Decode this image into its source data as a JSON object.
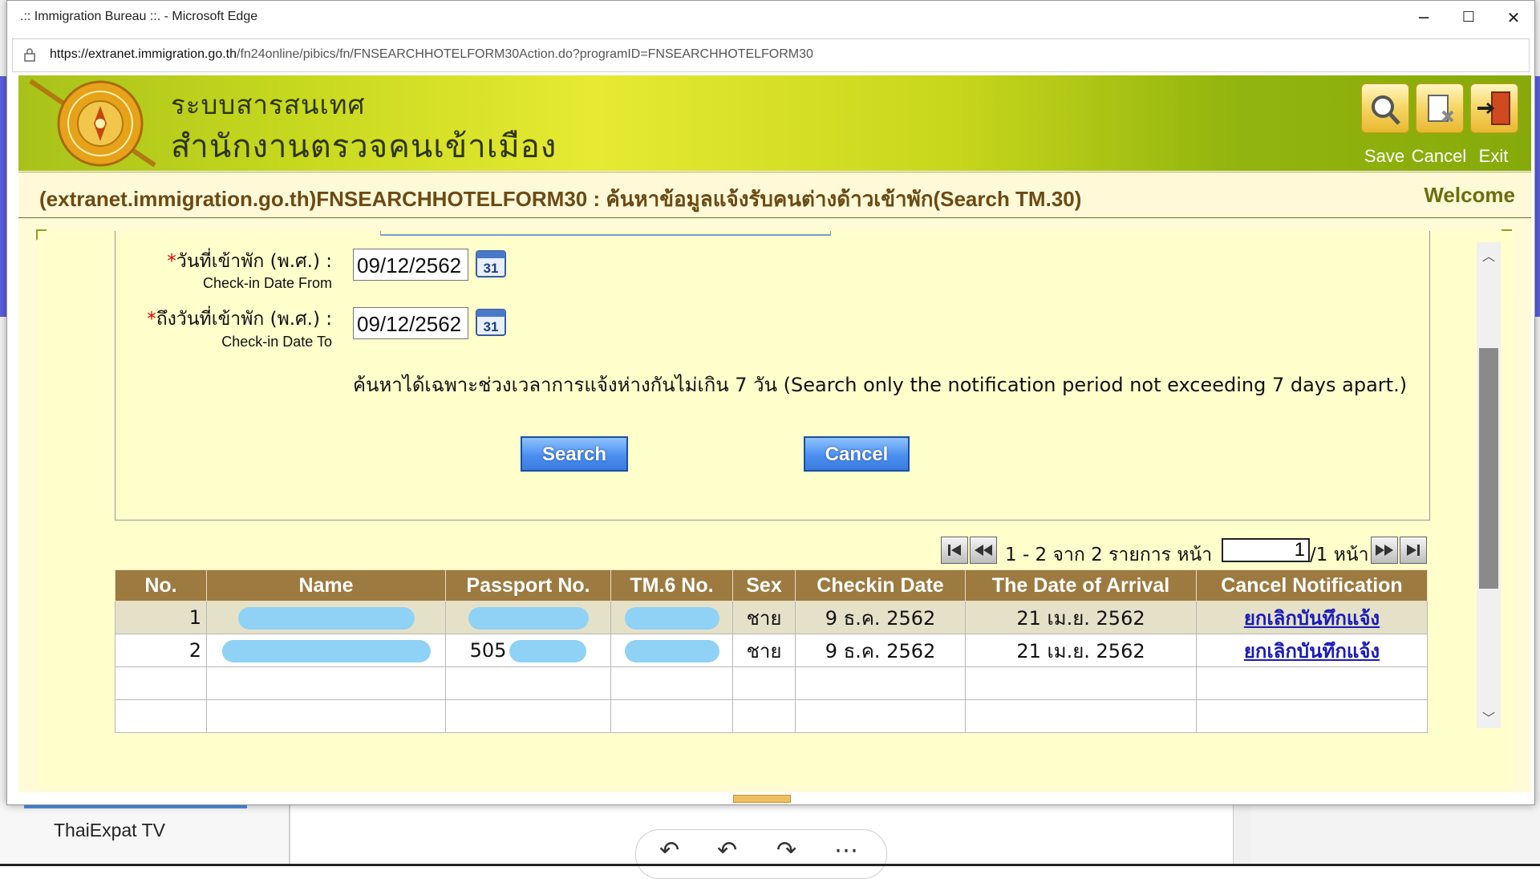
{
  "window": {
    "title": ".:: Immigration Bureau ::. - Microsoft Edge",
    "url_host": "https://extranet.immigration.go.th",
    "url_path": "/fn24online/pibics/fn/FNSEARCHHOTELFORM30Action.do?programID=FNSEARCHHOTELFORM30",
    "minimize": "─",
    "maximize": "☐",
    "close": "✕"
  },
  "header": {
    "title_th_line1": "ระบบสารสนเทศ",
    "title_th_line2": "สำนักงานตรวจคนเข้าเมือง",
    "buttons": {
      "save": "Save",
      "cancel": "Cancel",
      "exit": "Exit"
    }
  },
  "page": {
    "title": "(extranet.immigration.go.th)FNSEARCHHOTELFORM30 : ค้นหาข้อมูลแจ้งรับคนต่างด้าวเข้าพัก(Search TM.30)",
    "welcome": "Welcome"
  },
  "form": {
    "checkin_from": {
      "required_mark": "*",
      "label_th": "วันที่เข้าพัก (พ.ศ.) :",
      "label_en": "Check-in Date From",
      "value": "09/12/2562"
    },
    "checkin_to": {
      "required_mark": "*",
      "label_th": "ถึงวันที่เข้าพัก (พ.ศ.) :",
      "label_en": "Check-in Date To",
      "value": "09/12/2562"
    },
    "calendar_day": "31",
    "note": "ค้นหาได้เฉพาะช่วงเวลาการแจ้งห่างกันไม่เกิน 7 วัน (Search only the notification period not exceeding 7 days apart.)",
    "search_button": "Search",
    "cancel_button": "Cancel"
  },
  "pager": {
    "summary": "1 - 2 จาก 2 รายการ หน้า",
    "current_page": "1",
    "of_pages": "/1 หน้า"
  },
  "table": {
    "headers": [
      "No.",
      "Name",
      "Passport No.",
      "TM.6 No.",
      "Sex",
      "Checkin Date",
      "The Date of Arrival",
      "Cancel Notification"
    ],
    "rows": [
      {
        "no": "1",
        "sex": "ชาย",
        "checkin": "9 ธ.ค. 2562",
        "arrival": "21 เม.ย. 2562",
        "action": "ยกเลิกบันทึกแจ้ง"
      },
      {
        "no": "2",
        "passport_prefix": "505",
        "sex": "ชาย",
        "checkin": "9 ธ.ค. 2562",
        "arrival": "21 เม.ย. 2562",
        "action": "ยกเลิกบันทึกแจ้ง"
      }
    ]
  },
  "background": {
    "tab_label": "ThaiExpat TV"
  },
  "colors": {
    "header_green": "#c6d81e",
    "table_header": "#9c7a40",
    "content_bg": "#ffffcc",
    "button_blue": "#4b8ff0",
    "redaction": "#8fd2f5"
  }
}
